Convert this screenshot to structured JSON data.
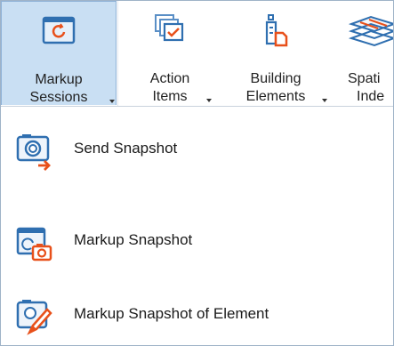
{
  "ribbon": {
    "buttons": [
      {
        "line1": "Markup",
        "line2": "Sessions",
        "icon": "markup-sessions-icon",
        "selected": true
      },
      {
        "line1": "Action",
        "line2": "Items",
        "icon": "action-items-icon",
        "selected": false
      },
      {
        "line1": "Building",
        "line2": "Elements",
        "icon": "building-elements-icon",
        "selected": false
      },
      {
        "line1": "Spati",
        "line2": "Inde",
        "icon": "spatial-index-icon",
        "selected": false
      }
    ]
  },
  "menu": {
    "items": [
      {
        "label": "Send Snapshot",
        "icon": "send-snapshot-icon"
      },
      {
        "label": "Markup Snapshot",
        "icon": "markup-snapshot-icon"
      },
      {
        "label": "Markup Snapshot of Element",
        "icon": "markup-snapshot-element-icon"
      }
    ]
  },
  "colors": {
    "selected_bg": "#c9dff3",
    "accent_orange": "#e8501a",
    "icon_blue": "#2f6fb0"
  }
}
